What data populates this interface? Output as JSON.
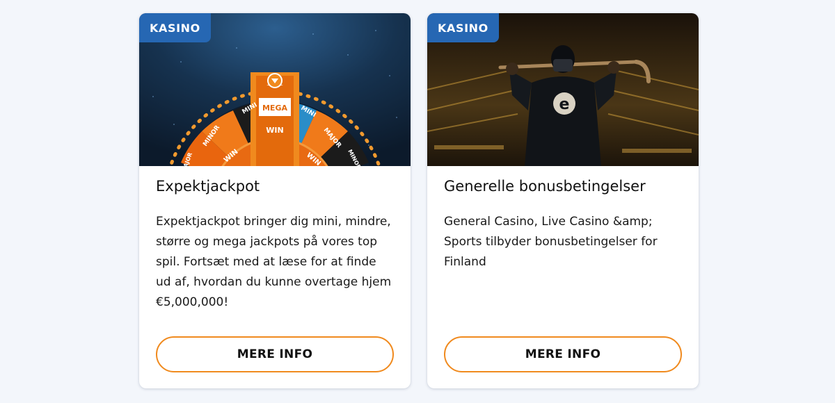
{
  "cards": [
    {
      "badge": "KASINO",
      "title": "Expektjackpot",
      "description": "Expektjackpot bringer dig mini, mindre, større og mega jackpots på vores top spil. Fortsæt med at læse for at finde ud af, hvordan du kunne overtage hjem €5,000,000!",
      "button_label": "MERE INFO",
      "image": {
        "mega": "MEGA",
        "win": "WIN",
        "mini": "MINI",
        "minor": "MINOR",
        "major": "MAJOR"
      }
    },
    {
      "badge": "KASINO",
      "title": "Generelle bonusbetingelser",
      "description": "General Casino, Live Casino &amp; Sports tilbyder bonusbetingelser for Finland",
      "button_label": "MERE INFO",
      "image": {
        "jersey_letter": "e"
      }
    }
  ],
  "colors": {
    "badge": "#2667b3",
    "button_border": "#f08a1e",
    "page_background": "#f3f6fb"
  }
}
